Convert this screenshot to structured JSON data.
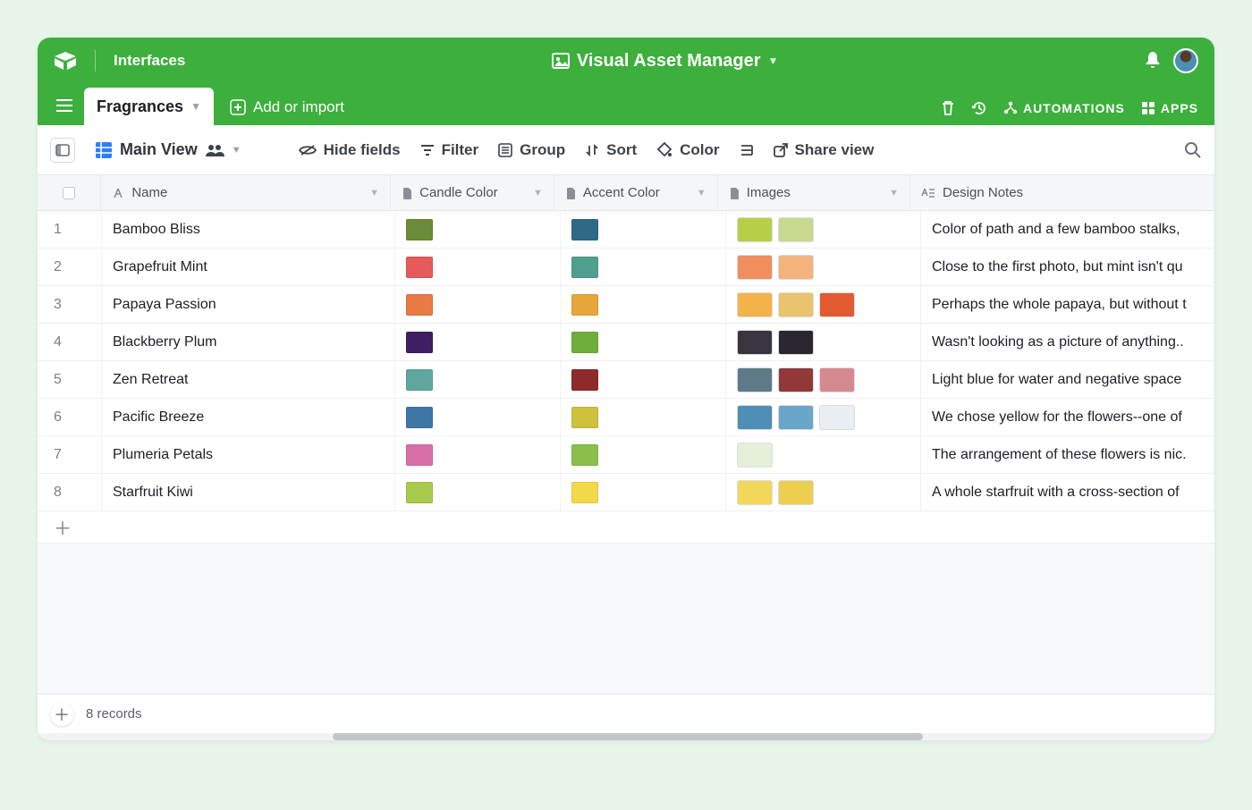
{
  "header": {
    "interfaces": "Interfaces",
    "title": "Visual Asset Manager"
  },
  "tabs": {
    "active": "Fragrances",
    "add_import": "Add or import",
    "automations": "AUTOMATIONS",
    "apps": "APPS"
  },
  "viewbar": {
    "main_view": "Main View",
    "hide_fields": "Hide fields",
    "filter": "Filter",
    "group": "Group",
    "sort": "Sort",
    "color": "Color",
    "share_view": "Share view"
  },
  "columns": {
    "name": "Name",
    "candle_color": "Candle Color",
    "accent_color": "Accent Color",
    "images": "Images",
    "design_notes": "Design Notes"
  },
  "records": [
    {
      "n": "1",
      "name": "Bamboo Bliss",
      "candle": "#6b8a3a",
      "accent": "#2e6a86",
      "imgs": [
        "#b6cf49",
        "#c7d98e"
      ],
      "notes": "Color of path and a few bamboo stalks,"
    },
    {
      "n": "2",
      "name": "Grapefruit Mint",
      "candle": "#e65a5a",
      "accent": "#4f9f8e",
      "imgs": [
        "#f08e5e",
        "#f4b27c"
      ],
      "notes": "Close to the first photo, but mint isn't qu"
    },
    {
      "n": "3",
      "name": "Papaya Passion",
      "candle": "#e87a43",
      "accent": "#e8a73c",
      "imgs": [
        "#f3b24a",
        "#e7c46d",
        "#e25a2f"
      ],
      "notes": "Perhaps the whole papaya, but without t"
    },
    {
      "n": "4",
      "name": "Blackberry Plum",
      "candle": "#3f1e63",
      "accent": "#6fae3c",
      "imgs": [
        "#3a3340",
        "#2b2730"
      ],
      "notes": "Wasn't looking as a picture of anything.."
    },
    {
      "n": "5",
      "name": "Zen Retreat",
      "candle": "#5fa6a0",
      "accent": "#8e2a2a",
      "imgs": [
        "#5e7a88",
        "#933838",
        "#d58a8f"
      ],
      "notes": "Light blue for water and negative space"
    },
    {
      "n": "6",
      "name": "Pacific Breeze",
      "candle": "#3f76a6",
      "accent": "#ccc23c",
      "imgs": [
        "#4f8fb7",
        "#6aa6c9",
        "#e9eef2"
      ],
      "notes": "We chose yellow for the flowers--one of"
    },
    {
      "n": "7",
      "name": "Plumeria Petals",
      "candle": "#d96fa9",
      "accent": "#89bf4a",
      "imgs": [
        "#e6efd8"
      ],
      "notes": "The arrangement of these flowers is nic."
    },
    {
      "n": "8",
      "name": "Starfruit Kiwi",
      "candle": "#a8c94a",
      "accent": "#f2d94a",
      "imgs": [
        "#f2d75a",
        "#eccf4e"
      ],
      "notes": "A whole starfruit with a cross-section of"
    }
  ],
  "footer": {
    "record_count": "8 records"
  }
}
